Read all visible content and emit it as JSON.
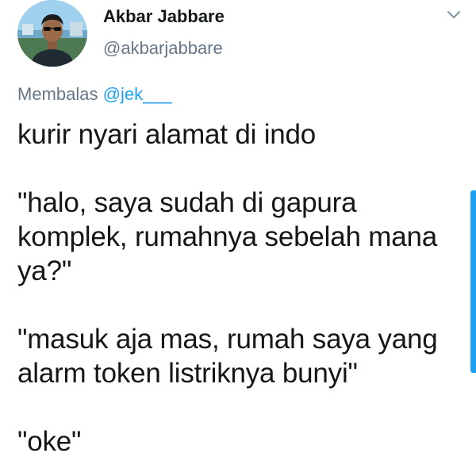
{
  "author": {
    "display_name": "Akbar Jabbare",
    "username": "@akbarjabbare",
    "avatar_icon": "profile-photo",
    "menu_icon": "chevron-down-icon"
  },
  "reply": {
    "prefix": "Membalas",
    "handle": "@jek___"
  },
  "tweet": {
    "line_1": "kurir nyari alamat di indo",
    "paragraph_2": "\"halo, saya sudah di gapura komplek, rumahnya sebelah mana ya?\"",
    "paragraph_3": "\"masuk aja mas, rumah saya yang alarm token listriknya bunyi\"",
    "paragraph_4": "\"oke\""
  },
  "colors": {
    "text": "#14171a",
    "secondary": "#657786",
    "accent": "#1da1f2"
  }
}
